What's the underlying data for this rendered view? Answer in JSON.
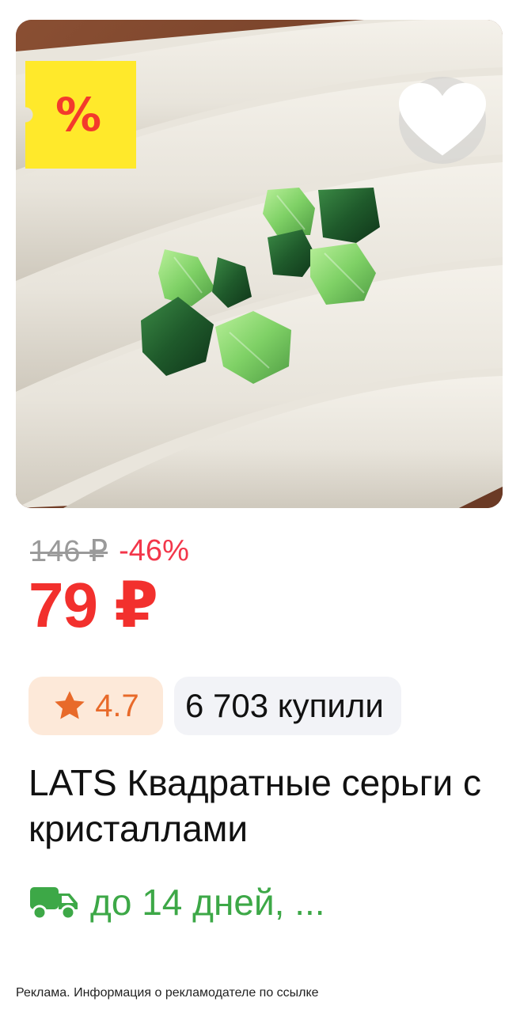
{
  "product_card": {
    "image": {
      "description_icon": "jewelry-photo",
      "favorite_icon": "heart-icon"
    },
    "discount_tag": {
      "label": "%",
      "color": "#ffe92b",
      "text_color": "#f33a2c"
    },
    "pricing": {
      "old_price": "146 ₽",
      "discount": "-46%",
      "price": "79 ₽",
      "price_color": "#f2302d"
    },
    "rating": {
      "icon": "star-icon",
      "value": "4.7",
      "accent": "#e86a2a"
    },
    "purchases": {
      "label": "6 703 купили"
    },
    "title": "LATS Квадратные серьги с кристаллами",
    "delivery": {
      "icon": "truck-icon",
      "text": "до 14 дней, ...",
      "color": "#3da847"
    },
    "ad_disclaimer": "Реклама. Информация о рекламодателе по ссылке"
  }
}
